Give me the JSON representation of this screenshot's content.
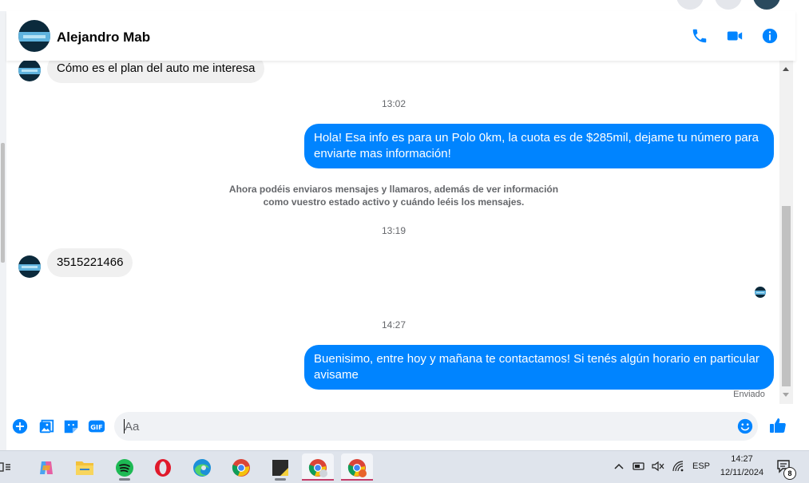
{
  "conversation": {
    "contact_name": "Alejandro Mab"
  },
  "messages": {
    "incoming_1": "Cómo es el plan del auto me interesa",
    "time_1": "13:02",
    "outgoing_1": "Hola! Esa info es para un Polo 0km, la cuota es de $285mil, dejame tu número para enviarte mas información!",
    "system_notice": "Ahora podéis enviaros mensajes y llamaros, además de ver información como vuestro estado activo y cuándo leéis los mensajes.",
    "time_2": "13:19",
    "incoming_2": "3515221466",
    "time_3": "14:27",
    "outgoing_2": "Buenisimo, entre hoy y mañana te contactamos! Si tenés algún horario en particular avisame",
    "status": "Enviado"
  },
  "composer": {
    "placeholder": "Aa",
    "gif_label": "GIF"
  },
  "taskbar": {
    "language": "ESP",
    "time": "14:27",
    "date": "12/11/2024",
    "notification_count": "8"
  },
  "colors": {
    "accent": "#0084ff",
    "incoming_bubble": "#f0f0f0"
  }
}
